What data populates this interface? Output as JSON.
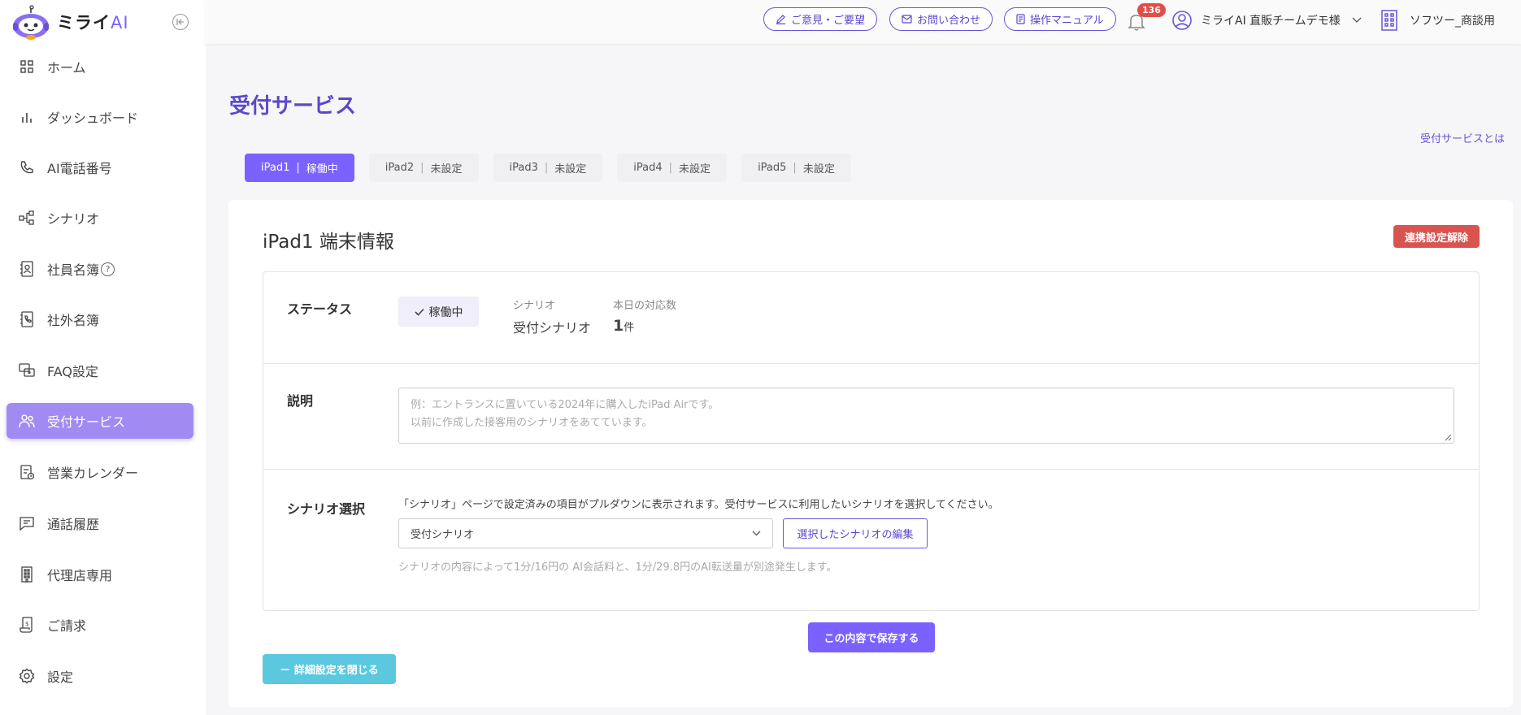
{
  "brand": {
    "name_main": "ミライ",
    "name_accent": "AI"
  },
  "sidebar": {
    "items": [
      {
        "label": "ホーム",
        "icon": "grid-icon"
      },
      {
        "label": "ダッシュボード",
        "icon": "bar-chart-icon"
      },
      {
        "label": "AI電話番号",
        "icon": "phone-icon"
      },
      {
        "label": "シナリオ",
        "icon": "flow-icon"
      },
      {
        "label": "社員名簿",
        "icon": "contact-book-icon"
      },
      {
        "label": "社外名簿",
        "icon": "phonebook-icon"
      },
      {
        "label": "FAQ設定",
        "icon": "faq-icon"
      },
      {
        "label": "受付サービス",
        "icon": "people-icon",
        "active": true
      },
      {
        "label": "営業カレンダー",
        "icon": "calendar-icon"
      },
      {
        "label": "通話履歴",
        "icon": "chat-icon"
      },
      {
        "label": "代理店専用",
        "icon": "building-icon"
      },
      {
        "label": "ご請求",
        "icon": "invoice-icon"
      },
      {
        "label": "設定",
        "icon": "gear-icon"
      }
    ],
    "help_glyph": "?"
  },
  "header": {
    "feedback_label": "ご意見・ご要望",
    "contact_label": "お問い合わせ",
    "manual_label": "操作マニュアル",
    "notification_count": "136",
    "user_name": "ミライAI 直販チームデモ様",
    "company_name": "ソフツー_商談用"
  },
  "page": {
    "title": "受付サービス",
    "about_link": "受付サービスとは",
    "tabs": [
      {
        "name": "iPad1",
        "status": "稼働中",
        "active": true
      },
      {
        "name": "iPad2",
        "status": "未設定"
      },
      {
        "name": "iPad3",
        "status": "未設定"
      },
      {
        "name": "iPad4",
        "status": "未設定"
      },
      {
        "name": "iPad5",
        "status": "未設定"
      }
    ],
    "tab_separator": "|"
  },
  "device": {
    "title": "iPad1 端末情報",
    "unlink_label": "連携設定解除",
    "status_label": "ステータス",
    "status_value": "稼働中",
    "scenario_key": "シナリオ",
    "scenario_value": "受付シナリオ",
    "today_key": "本日の対応数",
    "today_count": "1",
    "today_unit": "件",
    "description_label": "説明",
    "description_placeholder_1": "例：エントランスに置いている2024年に購入したiPad Airです。",
    "description_placeholder_2": "以前に作成した接客用のシナリオをあてています。",
    "scenario_select_label": "シナリオ選択",
    "scenario_hint": "「シナリオ」ページで設定済みの項目がプルダウンに表示されます。受付サービスに利用したいシナリオを選択してください。",
    "scenario_selected": "受付シナリオ",
    "edit_scenario_label": "選択したシナリオの編集",
    "fee_note": "シナリオの内容によって1分/16円の AI会話料と、1分/29.8円のAI転送量が別途発生します。",
    "save_label": "この内容で保存する",
    "close_details_label": "－ 詳細設定を閉じる"
  },
  "colors": {
    "accent": "#7b61ff",
    "danger": "#d9534f",
    "info": "#5bc8e0",
    "title": "#5a49c9"
  }
}
